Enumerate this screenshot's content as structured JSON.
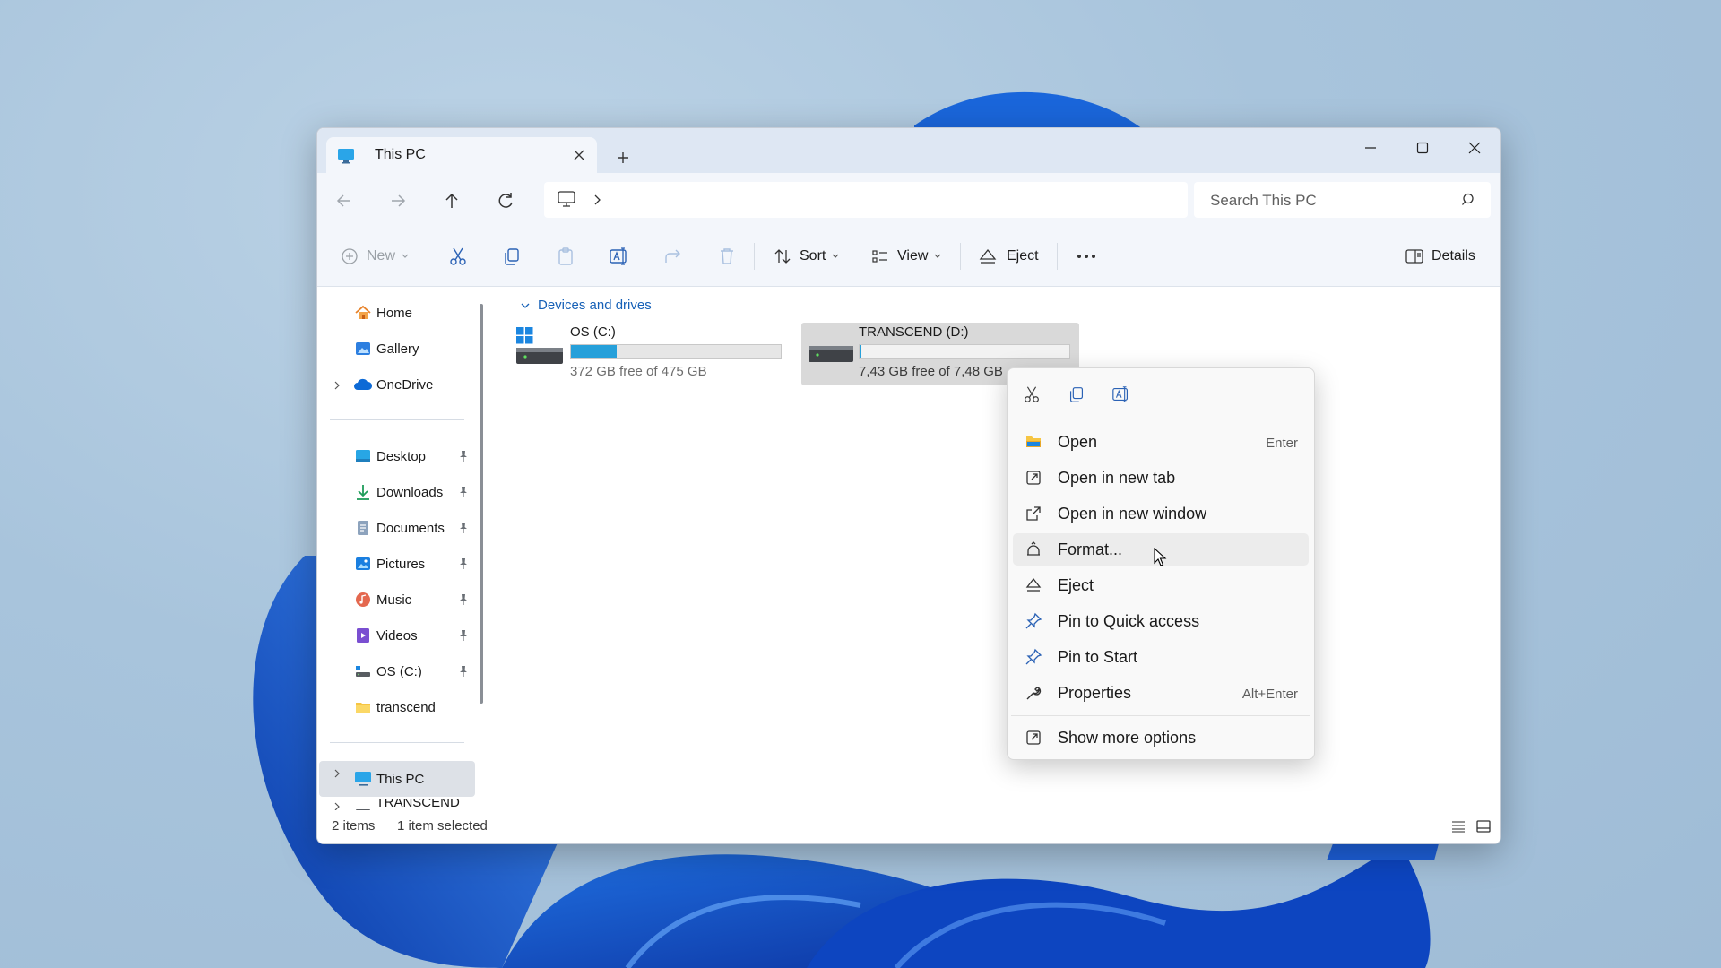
{
  "colors": {
    "accent": "#26a0da",
    "link_blue": "#1761b7",
    "folder_yellow": "#f6c543"
  },
  "tab": {
    "title": "This PC",
    "icon": "monitor-icon"
  },
  "navigation": {
    "back": "back-arrow-icon",
    "forward": "forward-arrow-icon",
    "up": "up-arrow-icon",
    "refresh": "refresh-icon",
    "address_icon": "monitor-icon",
    "address_chevron": "chevron-right-icon",
    "search_placeholder": "Search This PC"
  },
  "toolbar": {
    "new_label": "New",
    "sort_label": "Sort",
    "view_label": "View",
    "eject_label": "Eject",
    "details_label": "Details",
    "icons": [
      "cut-icon",
      "copy-icon",
      "paste-icon",
      "rename-icon",
      "share-icon",
      "delete-icon",
      "more-icon"
    ]
  },
  "sidebar": {
    "items": [
      {
        "label": "Home",
        "icon": "home-icon"
      },
      {
        "label": "Gallery",
        "icon": "gallery-icon"
      },
      {
        "label": "OneDrive",
        "icon": "cloud-icon"
      },
      {
        "label": "Desktop",
        "icon": "desktop-icon",
        "pinned": true
      },
      {
        "label": "Downloads",
        "icon": "download-icon",
        "pinned": true
      },
      {
        "label": "Documents",
        "icon": "documents-icon",
        "pinned": true
      },
      {
        "label": "Pictures",
        "icon": "pictures-icon",
        "pinned": true
      },
      {
        "label": "Music",
        "icon": "music-icon",
        "pinned": true
      },
      {
        "label": "Videos",
        "icon": "videos-icon",
        "pinned": true
      },
      {
        "label": "OS (C:)",
        "icon": "drive-icon",
        "pinned": true
      },
      {
        "label": "transcend",
        "icon": "folder-icon"
      },
      {
        "label": "This PC",
        "icon": "monitor-icon"
      },
      {
        "label": "TRANSCEND (D",
        "icon": "drive-icon"
      }
    ]
  },
  "content": {
    "group_header": "Devices and drives",
    "drives": [
      {
        "name": "OS (C:)",
        "free_text": "372 GB free of 475 GB",
        "used_fraction": 0.22
      },
      {
        "name": "TRANSCEND (D:)",
        "free_text": "7,43 GB free of 7,48 GB",
        "used_fraction": 0.01
      }
    ]
  },
  "status": {
    "items": "2 items",
    "selected": "1 item selected"
  },
  "context_menu": {
    "top_icons": [
      "cut-icon",
      "copy-icon",
      "rename-icon"
    ],
    "items": [
      {
        "label": "Open",
        "shortcut": "Enter",
        "icon": "folder-open-icon"
      },
      {
        "label": "Open in new tab",
        "shortcut": "",
        "icon": "new-tab-icon"
      },
      {
        "label": "Open in new window",
        "shortcut": "",
        "icon": "new-window-icon"
      },
      {
        "label": "Format...",
        "shortcut": "",
        "icon": "format-icon"
      },
      {
        "label": "Eject",
        "shortcut": "",
        "icon": "eject-icon"
      },
      {
        "label": "Pin to Quick access",
        "shortcut": "",
        "icon": "pin-icon"
      },
      {
        "label": "Pin to Start",
        "shortcut": "",
        "icon": "pin-icon"
      },
      {
        "label": "Properties",
        "shortcut": "Alt+Enter",
        "icon": "wrench-icon"
      },
      {
        "label": "Show more options",
        "shortcut": "",
        "icon": "more-options-icon"
      }
    ]
  }
}
